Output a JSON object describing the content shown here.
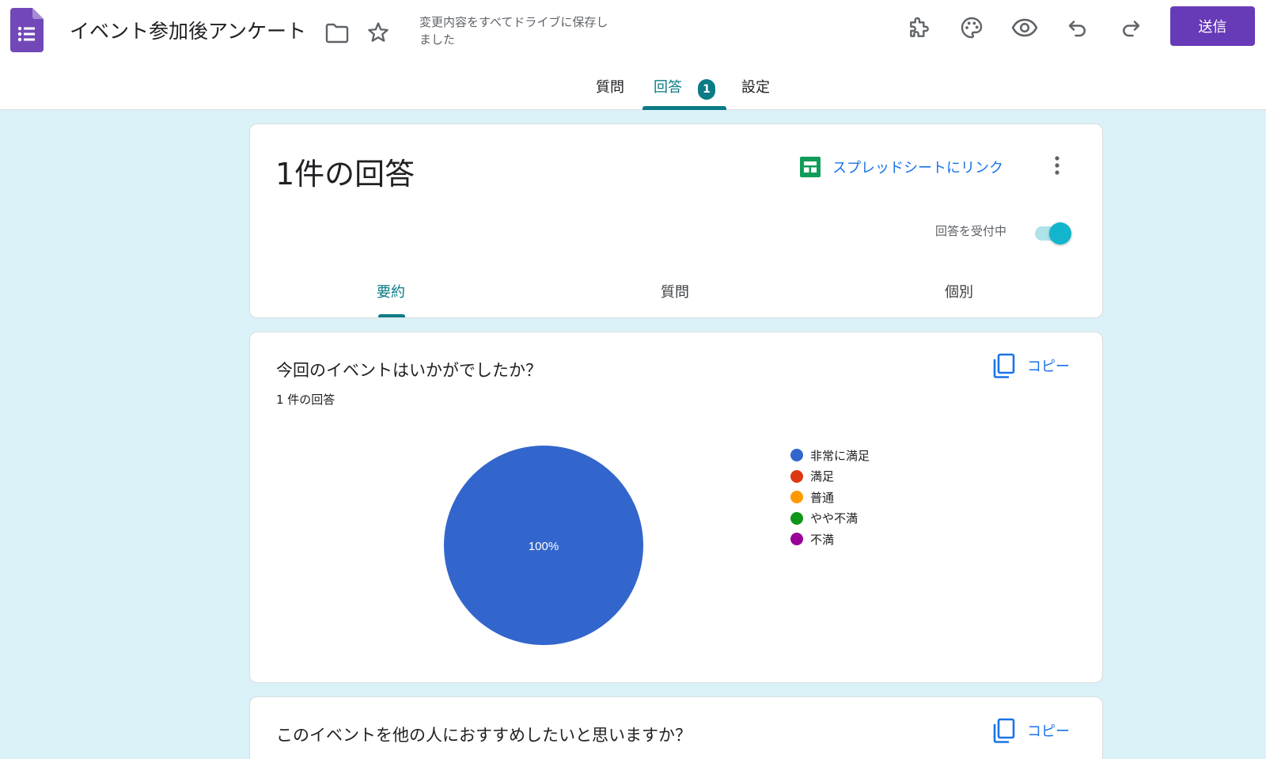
{
  "header": {
    "title": "イベント参加後アンケート",
    "save_status": "変更内容をすべてドライブに保存しました",
    "send_label": "送信",
    "icons": {
      "app": "google-forms-icon",
      "folder": "folder-icon",
      "star": "star-icon",
      "addon": "puzzle-icon",
      "palette": "palette-icon",
      "preview": "eye-icon",
      "undo": "undo-icon",
      "redo": "redo-icon"
    },
    "accent": "#673ab7"
  },
  "tabs": [
    {
      "label": "質問",
      "active": false
    },
    {
      "label": "回答",
      "active": true,
      "badge": "1"
    },
    {
      "label": "設定",
      "active": false
    }
  ],
  "summary": {
    "title": "1件の回答",
    "sheets_link": "スプレッドシートにリンク",
    "accepting_label": "回答を受付中",
    "accepting": true,
    "subtabs": [
      {
        "label": "要約",
        "active": true
      },
      {
        "label": "質問",
        "active": false
      },
      {
        "label": "個別",
        "active": false
      }
    ],
    "accent": "#0b7b85"
  },
  "questions": [
    {
      "title": "今回のイベントはいかがでしたか？",
      "response_count": "1 件の回答",
      "copy_label": "コピー"
    },
    {
      "title": "このイベントを他の人におすすめしたいと思いますか？",
      "copy_label": "コピー"
    }
  ],
  "chart_data": {
    "type": "pie",
    "categories": [
      "非常に満足",
      "満足",
      "普通",
      "やや不満",
      "不満"
    ],
    "values": [
      100,
      0,
      0,
      0,
      0
    ],
    "colors": [
      "#3366cc",
      "#dc3912",
      "#ff9900",
      "#109618",
      "#990099"
    ],
    "data_labels": [
      "100%"
    ],
    "legend": "right"
  }
}
